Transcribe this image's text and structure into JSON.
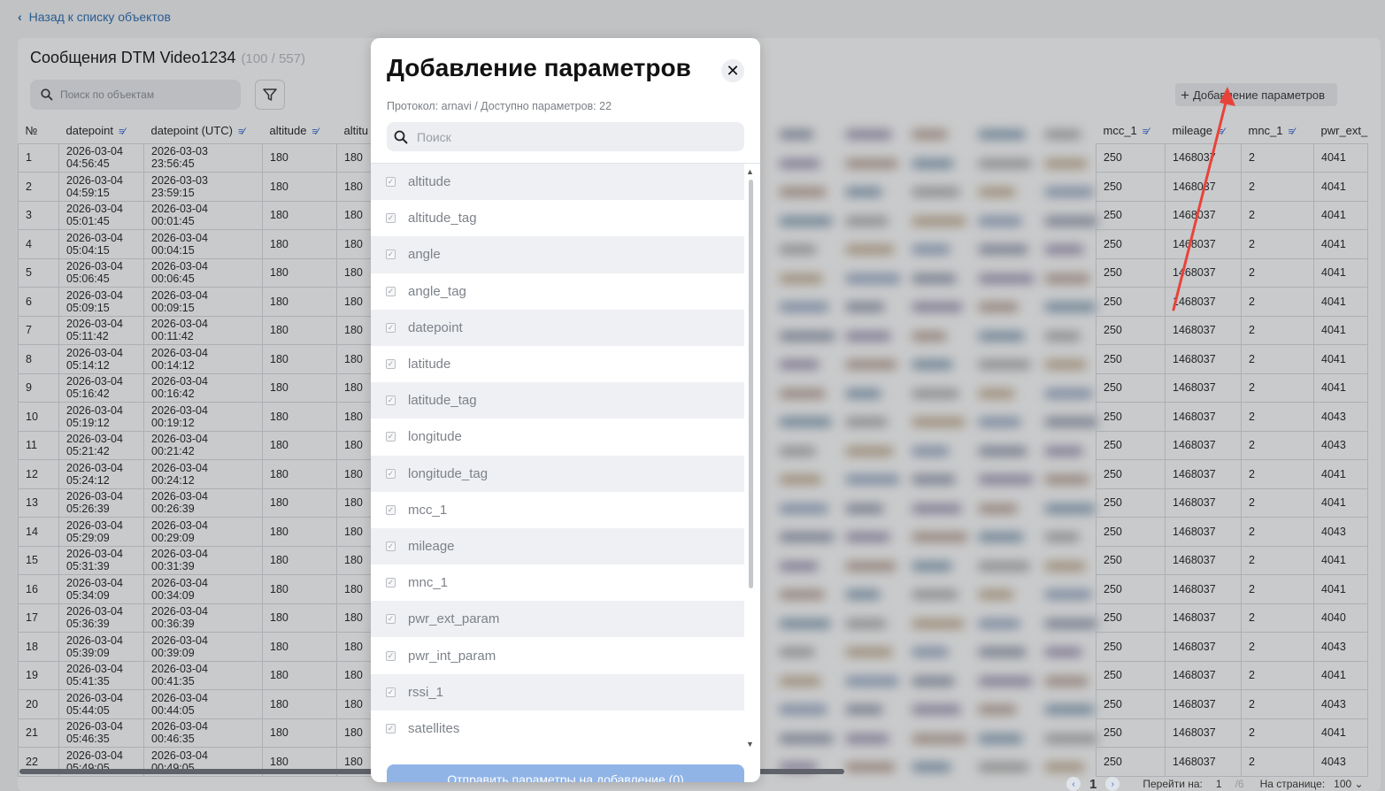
{
  "back_link": "Назад к списку объектов",
  "page": {
    "title": "Сообщения DTM Video1234",
    "count": "(100 / 557)",
    "search_placeholder": "Поиск по объектам",
    "add_params_label": "Добавление параметров"
  },
  "columns_left": [
    "№",
    "datepoint",
    "datepoint (UTC)",
    "altitude",
    "altitu"
  ],
  "columns_right": [
    "mcc_1",
    "mileage",
    "mnc_1",
    "pwr_ext_"
  ],
  "rows": [
    {
      "n": "1",
      "d1": "2026-03-04",
      "t1": "04:56:45",
      "d2": "2026-03-03",
      "t2": "23:56:45",
      "alt": "180",
      "alt2": "180",
      "mcc": "250",
      "mil": "1468037",
      "mnc": "2",
      "pwr": "4041"
    },
    {
      "n": "2",
      "d1": "2026-03-04",
      "t1": "04:59:15",
      "d2": "2026-03-03",
      "t2": "23:59:15",
      "alt": "180",
      "alt2": "180",
      "mcc": "250",
      "mil": "1468037",
      "mnc": "2",
      "pwr": "4041"
    },
    {
      "n": "3",
      "d1": "2026-03-04",
      "t1": "05:01:45",
      "d2": "2026-03-04",
      "t2": "00:01:45",
      "alt": "180",
      "alt2": "180",
      "mcc": "250",
      "mil": "1468037",
      "mnc": "2",
      "pwr": "4041"
    },
    {
      "n": "4",
      "d1": "2026-03-04",
      "t1": "05:04:15",
      "d2": "2026-03-04",
      "t2": "00:04:15",
      "alt": "180",
      "alt2": "180",
      "mcc": "250",
      "mil": "1468037",
      "mnc": "2",
      "pwr": "4041"
    },
    {
      "n": "5",
      "d1": "2026-03-04",
      "t1": "05:06:45",
      "d2": "2026-03-04",
      "t2": "00:06:45",
      "alt": "180",
      "alt2": "180",
      "mcc": "250",
      "mil": "1468037",
      "mnc": "2",
      "pwr": "4041"
    },
    {
      "n": "6",
      "d1": "2026-03-04",
      "t1": "05:09:15",
      "d2": "2026-03-04",
      "t2": "00:09:15",
      "alt": "180",
      "alt2": "180",
      "mcc": "250",
      "mil": "1468037",
      "mnc": "2",
      "pwr": "4041"
    },
    {
      "n": "7",
      "d1": "2026-03-04",
      "t1": "05:11:42",
      "d2": "2026-03-04",
      "t2": "00:11:42",
      "alt": "180",
      "alt2": "180",
      "mcc": "250",
      "mil": "1468037",
      "mnc": "2",
      "pwr": "4041"
    },
    {
      "n": "8",
      "d1": "2026-03-04",
      "t1": "05:14:12",
      "d2": "2026-03-04",
      "t2": "00:14:12",
      "alt": "180",
      "alt2": "180",
      "mcc": "250",
      "mil": "1468037",
      "mnc": "2",
      "pwr": "4041"
    },
    {
      "n": "9",
      "d1": "2026-03-04",
      "t1": "05:16:42",
      "d2": "2026-03-04",
      "t2": "00:16:42",
      "alt": "180",
      "alt2": "180",
      "mcc": "250",
      "mil": "1468037",
      "mnc": "2",
      "pwr": "4041"
    },
    {
      "n": "10",
      "d1": "2026-03-04",
      "t1": "05:19:12",
      "d2": "2026-03-04",
      "t2": "00:19:12",
      "alt": "180",
      "alt2": "180",
      "mcc": "250",
      "mil": "1468037",
      "mnc": "2",
      "pwr": "4043"
    },
    {
      "n": "11",
      "d1": "2026-03-04",
      "t1": "05:21:42",
      "d2": "2026-03-04",
      "t2": "00:21:42",
      "alt": "180",
      "alt2": "180",
      "mcc": "250",
      "mil": "1468037",
      "mnc": "2",
      "pwr": "4043"
    },
    {
      "n": "12",
      "d1": "2026-03-04",
      "t1": "05:24:12",
      "d2": "2026-03-04",
      "t2": "00:24:12",
      "alt": "180",
      "alt2": "180",
      "mcc": "250",
      "mil": "1468037",
      "mnc": "2",
      "pwr": "4041"
    },
    {
      "n": "13",
      "d1": "2026-03-04",
      "t1": "05:26:39",
      "d2": "2026-03-04",
      "t2": "00:26:39",
      "alt": "180",
      "alt2": "180",
      "mcc": "250",
      "mil": "1468037",
      "mnc": "2",
      "pwr": "4041"
    },
    {
      "n": "14",
      "d1": "2026-03-04",
      "t1": "05:29:09",
      "d2": "2026-03-04",
      "t2": "00:29:09",
      "alt": "180",
      "alt2": "180",
      "mcc": "250",
      "mil": "1468037",
      "mnc": "2",
      "pwr": "4043"
    },
    {
      "n": "15",
      "d1": "2026-03-04",
      "t1": "05:31:39",
      "d2": "2026-03-04",
      "t2": "00:31:39",
      "alt": "180",
      "alt2": "180",
      "mcc": "250",
      "mil": "1468037",
      "mnc": "2",
      "pwr": "4041"
    },
    {
      "n": "16",
      "d1": "2026-03-04",
      "t1": "05:34:09",
      "d2": "2026-03-04",
      "t2": "00:34:09",
      "alt": "180",
      "alt2": "180",
      "mcc": "250",
      "mil": "1468037",
      "mnc": "2",
      "pwr": "4041"
    },
    {
      "n": "17",
      "d1": "2026-03-04",
      "t1": "05:36:39",
      "d2": "2026-03-04",
      "t2": "00:36:39",
      "alt": "180",
      "alt2": "180",
      "mcc": "250",
      "mil": "1468037",
      "mnc": "2",
      "pwr": "4040"
    },
    {
      "n": "18",
      "d1": "2026-03-04",
      "t1": "05:39:09",
      "d2": "2026-03-04",
      "t2": "00:39:09",
      "alt": "180",
      "alt2": "180",
      "mcc": "250",
      "mil": "1468037",
      "mnc": "2",
      "pwr": "4043"
    },
    {
      "n": "19",
      "d1": "2026-03-04",
      "t1": "05:41:35",
      "d2": "2026-03-04",
      "t2": "00:41:35",
      "alt": "180",
      "alt2": "180",
      "mcc": "250",
      "mil": "1468037",
      "mnc": "2",
      "pwr": "4041"
    },
    {
      "n": "20",
      "d1": "2026-03-04",
      "t1": "05:44:05",
      "d2": "2026-03-04",
      "t2": "00:44:05",
      "alt": "180",
      "alt2": "180",
      "mcc": "250",
      "mil": "1468037",
      "mnc": "2",
      "pwr": "4043"
    },
    {
      "n": "21",
      "d1": "2026-03-04",
      "t1": "05:46:35",
      "d2": "2026-03-04",
      "t2": "00:46:35",
      "alt": "180",
      "alt2": "180",
      "mcc": "250",
      "mil": "1468037",
      "mnc": "2",
      "pwr": "4041"
    },
    {
      "n": "22",
      "d1": "2026-03-04",
      "t1": "05:49:05",
      "d2": "2026-03-04",
      "t2": "00:49:05",
      "alt": "180",
      "alt2": "180",
      "mcc": "250",
      "mil": "1468037",
      "mnc": "2",
      "pwr": "4043"
    }
  ],
  "pager": {
    "current": "1",
    "goto_label": "Перейти на:",
    "goto_value": "1",
    "total_pages": "/6",
    "per_page_label": "На странице:",
    "per_page_value": "100"
  },
  "modal": {
    "title": "Добавление параметров",
    "subtitle": "Протокол: arnavi / Доступно параметров: 22",
    "search_placeholder": "Поиск",
    "submit_label": "Отправить параметры на добавление (0)",
    "items": [
      "altitude",
      "altitude_tag",
      "angle",
      "angle_tag",
      "datepoint",
      "latitude",
      "latitude_tag",
      "longitude",
      "longitude_tag",
      "mcc_1",
      "mileage",
      "mnc_1",
      "pwr_ext_param",
      "pwr_int_param",
      "rssi_1",
      "satellites"
    ]
  },
  "colors": {
    "accent": "#3b6fd6",
    "link": "#2b6cb0",
    "submit_disabled": "#90b4e6",
    "annotation_arrow": "#e8433a"
  }
}
